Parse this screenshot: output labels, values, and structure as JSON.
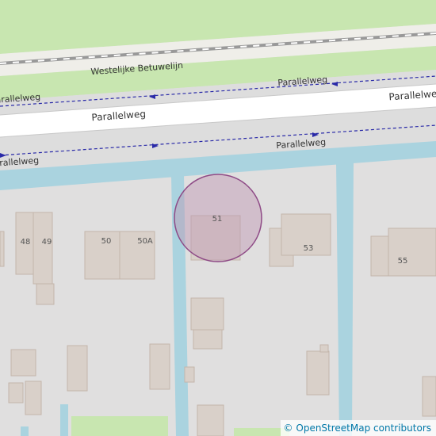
{
  "map": {
    "roads": {
      "railway": "Westelijke Betuwelijn",
      "street": "Parallelweg"
    },
    "house_numbers": [
      "48",
      "49",
      "50",
      "50A",
      "51",
      "53",
      "55"
    ],
    "marker": {
      "label": "51",
      "color": "#8e4a86"
    },
    "colors": {
      "grass": "#c8e6b0",
      "water": "#aad3df",
      "road": "#ffffff",
      "building": "#d9d0c9",
      "landuse": "#e0dfdf"
    }
  },
  "attribution": {
    "symbol": "©",
    "text": "OpenStreetMap contributors"
  }
}
